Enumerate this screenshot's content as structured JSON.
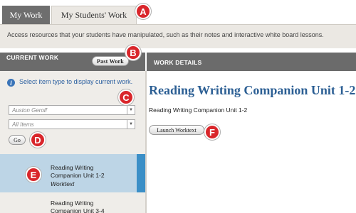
{
  "tabs": {
    "my_work": "My Work",
    "my_students_work": "My Students' Work"
  },
  "description": "Access resources that your students have manipulated, such as their notes and interactive white board lessons.",
  "current_work": {
    "header": "Current Work",
    "past_work_button": "Past Work",
    "info_text": "Select item type to display current work.",
    "student_select": "Auston Gerolf",
    "items_select": "All Items",
    "go_button": "Go",
    "items": [
      {
        "line1": "Reading Writing",
        "line2": "Companion Unit 1-2",
        "type": "Worktext",
        "selected": true
      },
      {
        "line1": "Reading Writing",
        "line2": "Companion Unit 3-4"
      }
    ]
  },
  "work_details": {
    "header": "Work Details",
    "title": "Reading Writing Companion Unit 1-2",
    "subtitle": "Reading Writing Companion Unit 1-2",
    "launch_button": "Launch Worktext"
  },
  "callouts": [
    "A",
    "B",
    "C",
    "D",
    "E",
    "F"
  ],
  "colors": {
    "accent_blue": "#2c5f94",
    "selected_bg": "#bdd5e6",
    "selected_bar": "#3b8fc7",
    "header_gray": "#6b6b6b",
    "callout_red": "#d9262b"
  },
  "icons": {
    "info": "info-icon",
    "dropdown": "chevron-down-icon"
  }
}
